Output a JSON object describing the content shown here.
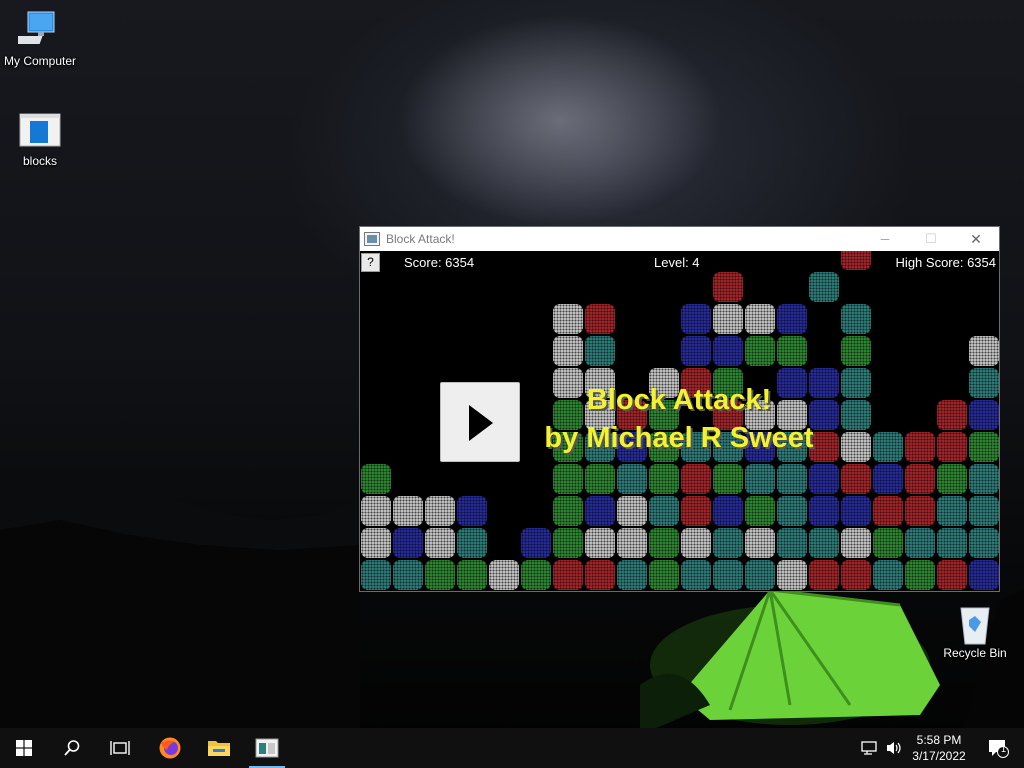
{
  "desktop": {
    "icons": [
      {
        "label": "My Computer",
        "icon": "computer-icon"
      },
      {
        "label": "blocks",
        "icon": "app-window-icon"
      },
      {
        "label": "Recycle Bin",
        "icon": "recycle-bin-icon"
      }
    ]
  },
  "window": {
    "title": "Block Attack!",
    "controls": [
      "minimize",
      "maximize",
      "close"
    ],
    "minimize_glyph": "─",
    "maximize_glyph": "☐",
    "close_glyph": "✕"
  },
  "game": {
    "help_label": "?",
    "score_label": "Score: 6354",
    "level_label": "Level: 4",
    "high_score_label": "High Score: 6354",
    "banner_line1": "Block Attack!",
    "banner_line2": "by Michael R Sweet",
    "banner_color": "#f2f230",
    "colors": {
      "W": "#c8c8c8",
      "R": "#a8262b",
      "B": "#272d9e",
      "G": "#2f8a33",
      "T": "#2f7f7c"
    },
    "rows": [
      "...............R....",
      "...........R..T.....",
      "......WR..BWWB.T....",
      "......WT..BBGG.G...W",
      "......WW.WRG.BBT...T",
      "......GWRG.RWWBT..RB",
      "......GTBGTTBTRWTRRG",
      "G.....GGTGRGTTBRBRGT",
      "WWWB..GBWTRBGTBBRRTT",
      "WBWT.BGWWGWTWTTWGTTT",
      "TTGGWGRRTGTTTWRRTGRB"
    ]
  },
  "taskbar": {
    "items": [
      "start",
      "search",
      "task-view",
      "firefox",
      "file-explorer",
      "block-attack"
    ],
    "clock_time": "5:58 PM",
    "clock_date": "3/17/2022",
    "notification_count": "1"
  }
}
